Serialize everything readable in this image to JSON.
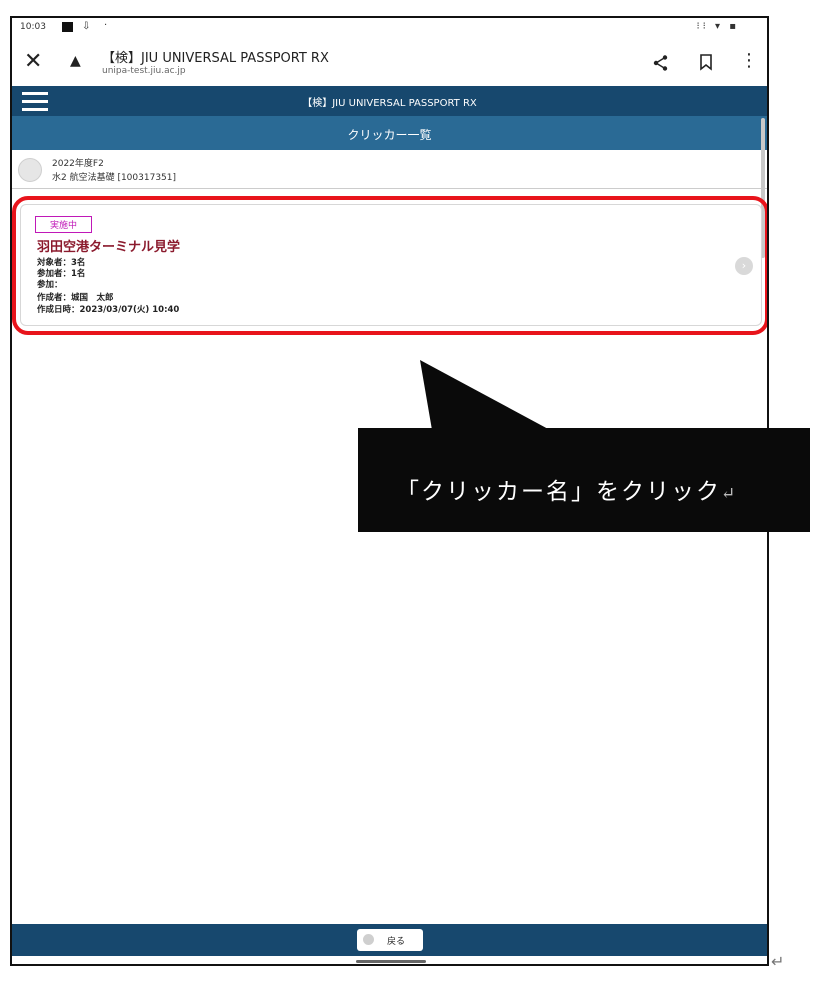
{
  "status_bar": {
    "time": "10:03",
    "left_icons": [
      "notification-square-icon",
      "download-icon",
      "dot"
    ],
    "right_icons": "⁝⁝ ▾ ▪"
  },
  "browser": {
    "title": "【検】JIU UNIVERSAL PASSPORT RX",
    "url": "unipa-test.jiu.ac.jp",
    "icons": [
      "close-icon",
      "lock-icon",
      "share-icon",
      "bookmark-icon",
      "more-icon"
    ]
  },
  "app": {
    "title": "【検】JIU UNIVERSAL PASSPORT RX",
    "page_title": "クリッカー一覧"
  },
  "course": {
    "line1": "2022年度F2",
    "line2": "水2 航空法基礎 [100317351]"
  },
  "clicker": {
    "status": "実施中",
    "name": "羽田空港ターミナル見学",
    "details": [
      "対象者：3名",
      "参加者：1名",
      "参加：",
      "作成者：城国　太郎",
      "作成日時：2023/03/07(火) 10:40"
    ]
  },
  "callout": {
    "text": "「クリッカー名」をクリック",
    "return_mark": "↵"
  },
  "footer": {
    "back_label": "戻る"
  },
  "outer_return_mark": "↵",
  "colors": {
    "app_bar": "#17486e",
    "header": "#2a6a95",
    "highlight": "#e8141b",
    "badge": "#c018b8",
    "clicker_name": "#8b1a2d"
  }
}
